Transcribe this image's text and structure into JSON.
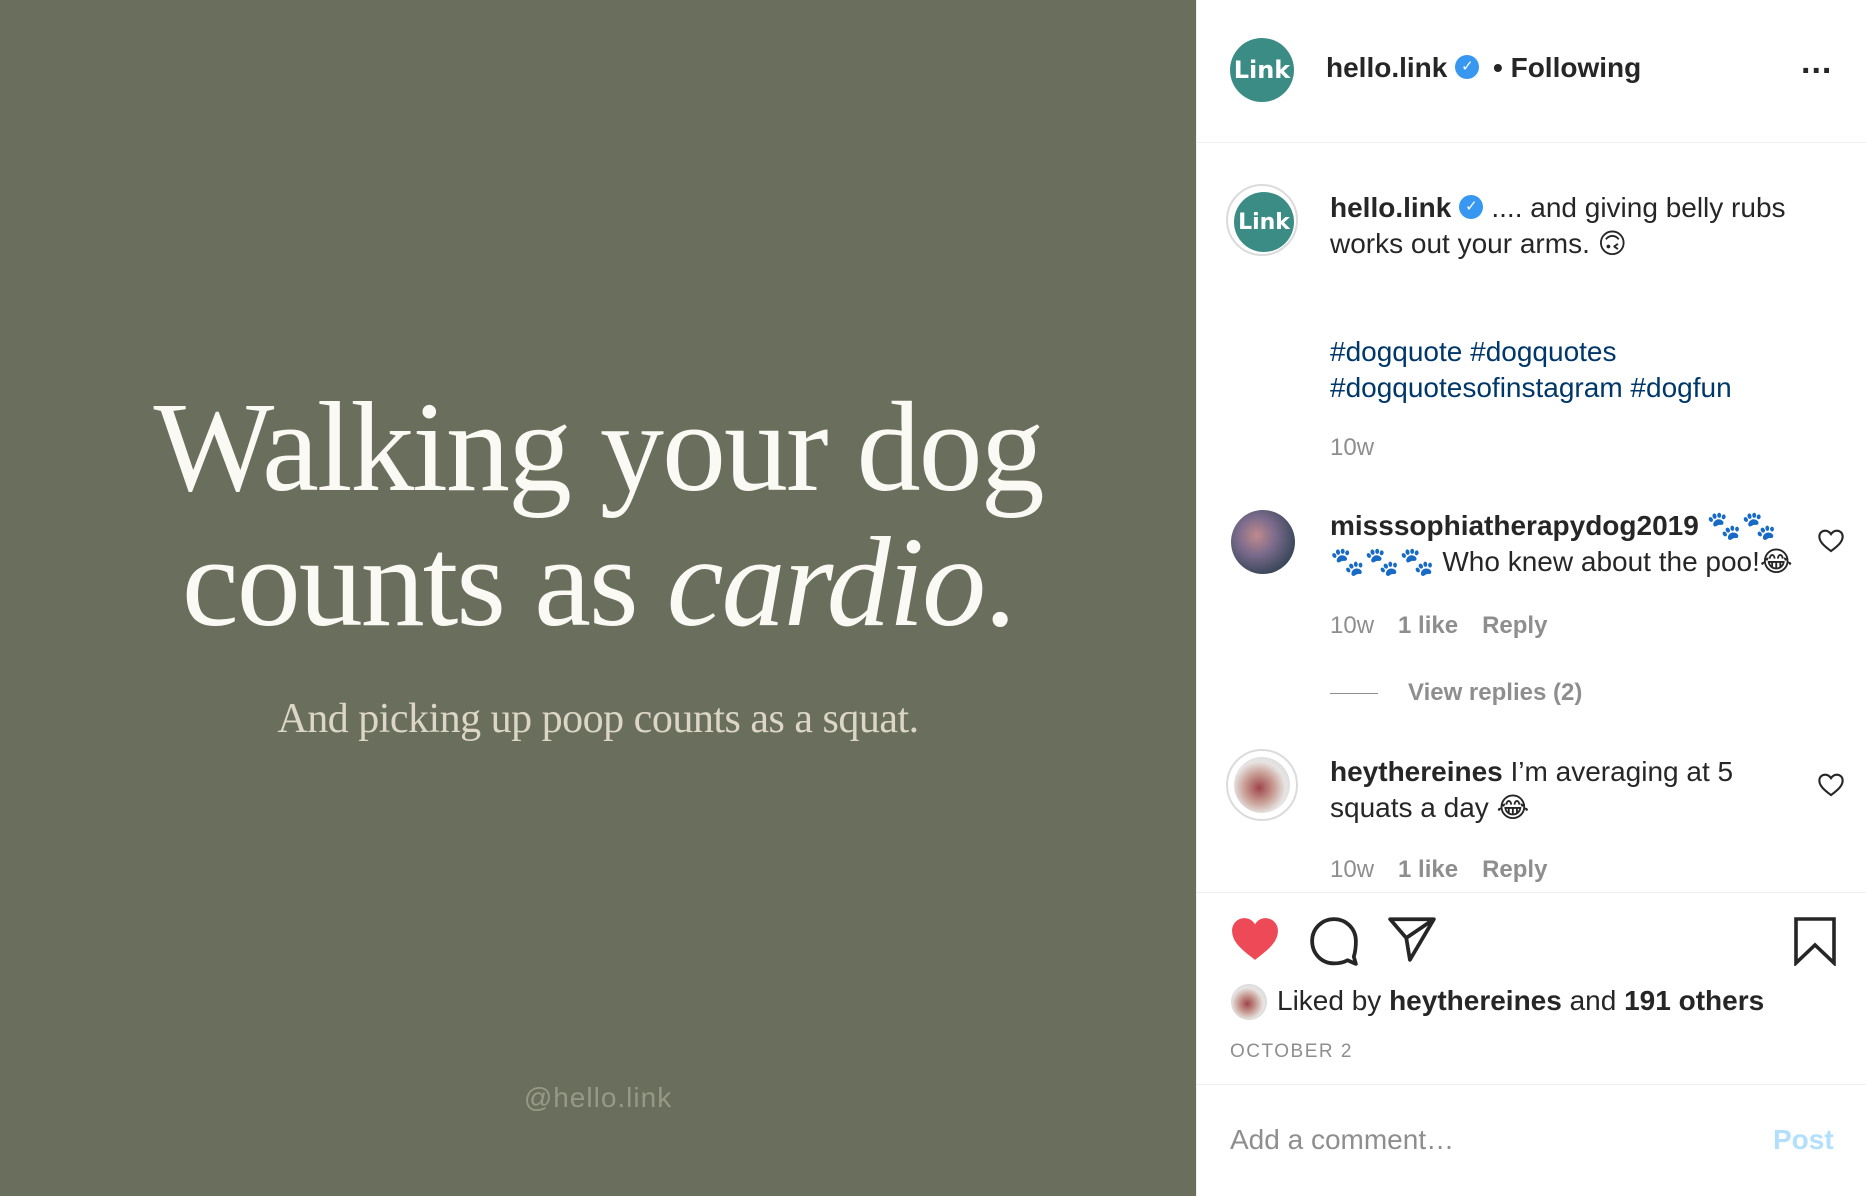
{
  "image": {
    "line1": "Walking your dog",
    "line2_prefix": "counts as ",
    "line2_italic": "cardio",
    "line2_suffix": ".",
    "subtitle": "And picking up poop counts as a squat.",
    "handle": "@hello.link"
  },
  "header": {
    "avatar_text": "Link",
    "username": "hello.link",
    "verified_glyph": "✓",
    "separator": "•",
    "follow_status": "Following",
    "more_glyph": "..."
  },
  "caption": {
    "avatar_text": "Link",
    "username": "hello.link",
    "text": ".... and giving belly rubs works out your arms. 🙃",
    "hashtags": "#dogquote #dogquotes #dogquotesofinstagram #dogfun",
    "age": "10w"
  },
  "comments": [
    {
      "username": "misssophiatherapydog2019",
      "text": "🐾🐾🐾🐾🐾 Who knew about the poo!😂",
      "age": "10w",
      "likes": "1 like",
      "reply": "Reply"
    },
    {
      "username": "heythereines",
      "text": "I’m averaging at 5 squats a day 😂",
      "age": "10w",
      "likes": "1 like",
      "reply": "Reply"
    }
  ],
  "view_replies": "View replies (2)",
  "actions": {
    "like_icon": "heart-filled",
    "comment_icon": "speech-bubble",
    "share_icon": "paper-plane",
    "save_icon": "bookmark"
  },
  "likes": {
    "prefix": "Liked by ",
    "user": "heythereines",
    "middle": " and ",
    "others": "191 others"
  },
  "date": "OCTOBER 2",
  "composer": {
    "placeholder": "Add a comment…",
    "post_label": "Post"
  },
  "colors": {
    "photo_bg": "#6a6e5c",
    "brand_teal": "#3c8c86",
    "verified_blue": "#3897f0",
    "hashtag_blue": "#00376b",
    "like_red": "#ed4956",
    "post_disabled": "#b2dffc"
  }
}
